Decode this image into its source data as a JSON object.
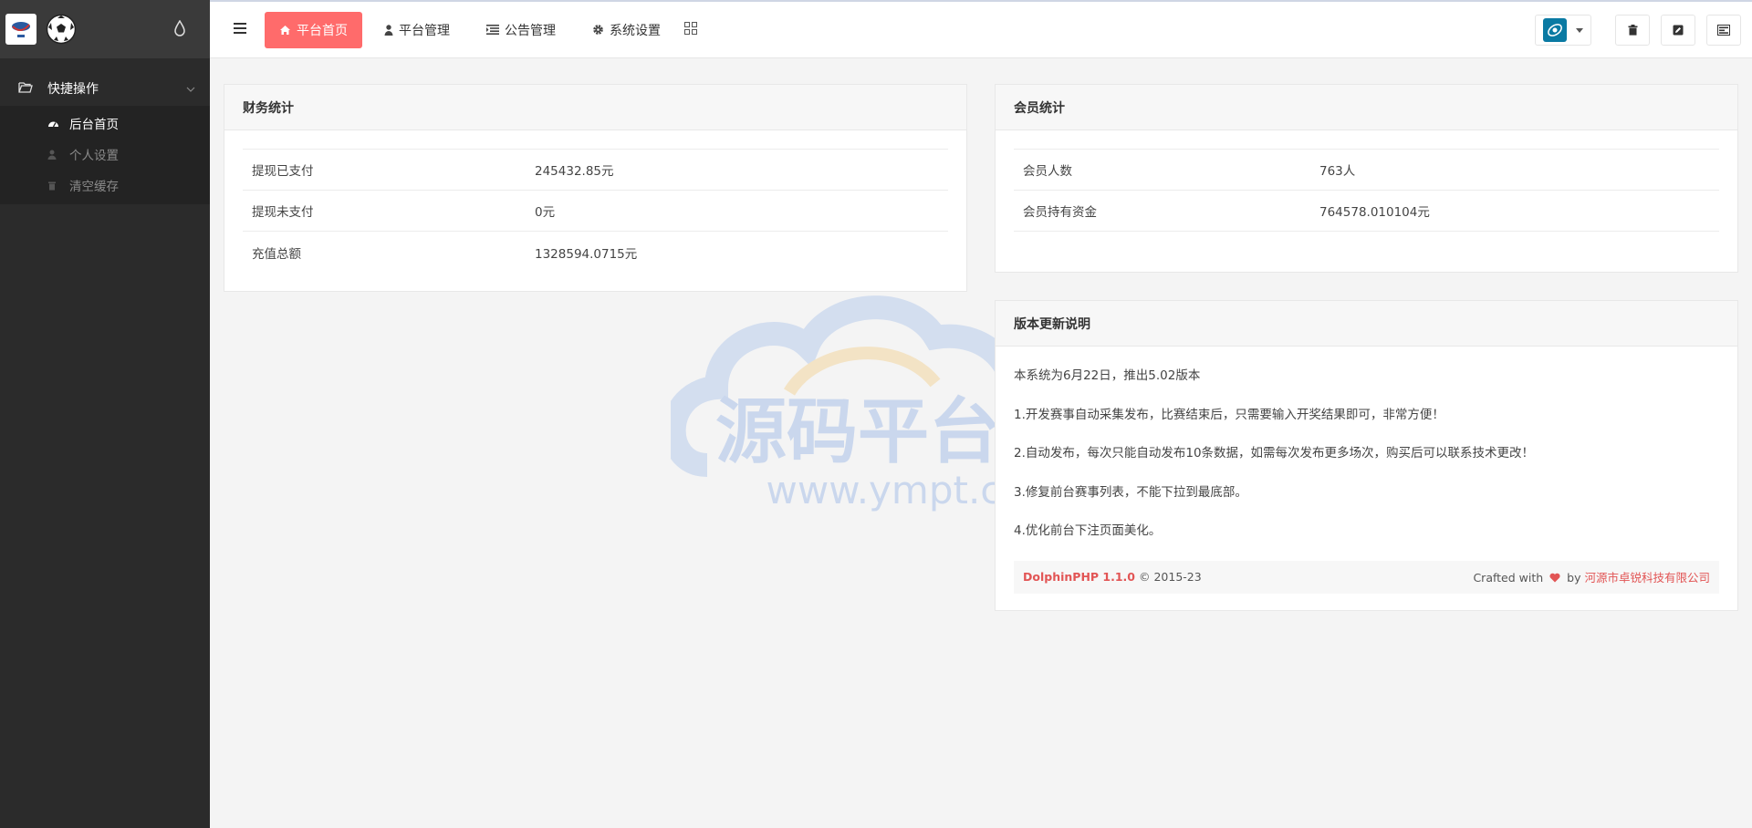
{
  "sidebar": {
    "group_label": "快捷操作",
    "items": [
      {
        "label": "后台首页",
        "icon": "dashboard-icon",
        "active": true
      },
      {
        "label": "个人设置",
        "icon": "user-icon",
        "active": false
      },
      {
        "label": "清空缓存",
        "icon": "trash-icon",
        "active": false
      }
    ]
  },
  "header": {
    "nav": [
      {
        "label": "平台首页",
        "icon": "home-icon",
        "active": true
      },
      {
        "label": "平台管理",
        "icon": "user-icon"
      },
      {
        "label": "公告管理",
        "icon": "list-icon"
      },
      {
        "label": "系统设置",
        "icon": "gear-icon"
      }
    ]
  },
  "finance": {
    "title": "财务统计",
    "rows": [
      {
        "label": "提现已支付",
        "value": "245432.85元"
      },
      {
        "label": "提现未支付",
        "value": "0元"
      },
      {
        "label": "充值总额",
        "value": "1328594.0715元"
      }
    ]
  },
  "members": {
    "title": "会员统计",
    "rows": [
      {
        "label": "会员人数",
        "value": "763人"
      },
      {
        "label": "会员持有资金",
        "value": "764578.010104元"
      }
    ]
  },
  "version": {
    "title": "版本更新说明",
    "lines": [
      "本系统为6月22日，推出5.02版本",
      "1.开发赛事自动采集发布，比赛结束后，只需要输入开奖结果即可，非常方便！",
      "2.自动发布，每次只能自动发布10条数据，如需每次发布更多场次，购买后可以联系技术更改！",
      "3.修复前台赛事列表，不能下拉到最底部。",
      "4.优化前台下注页面美化。"
    ]
  },
  "footer": {
    "product": "DolphinPHP 1.1.0",
    "copyright": "© 2015-23",
    "crafted_with": "Crafted with",
    "by": "by",
    "company": "河源市卓锐科技有限公司"
  },
  "watermark": {
    "title": "源码平台",
    "url": "www.ympt.cc"
  },
  "colors": {
    "accent": "#ff6b6b",
    "sidebar_bg": "#2b2b2b"
  }
}
